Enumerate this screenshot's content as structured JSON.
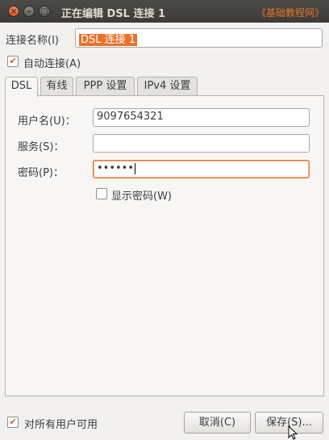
{
  "window": {
    "title": "正在编辑 DSL 连接 1",
    "watermark": "《基础教程网》",
    "close_glyph": "×",
    "min_glyph": "–",
    "max_glyph": "□"
  },
  "connection_name": {
    "label": "连接名称(I)",
    "value": "DSL 连接 1"
  },
  "auto_connect": {
    "label": "自动连接(A)",
    "checked": true,
    "check_glyph": "✔"
  },
  "tabs": [
    {
      "label": "DSL",
      "active": true
    },
    {
      "label": "有线",
      "active": false
    },
    {
      "label": "PPP 设置",
      "active": false
    },
    {
      "label": "IPv4 设置",
      "active": false
    }
  ],
  "dsl": {
    "username_label": "用户名(U)：",
    "username_value": "9097654321",
    "service_label": "服务(S)：",
    "service_value": "",
    "password_label": "密码(P)：",
    "password_value": "••••••",
    "show_password_label": "显示密码(W)"
  },
  "footer": {
    "all_users_label": "对所有用户可用",
    "cancel_label": "取消(C)",
    "save_label": "保存(S)..."
  },
  "colors": {
    "accent": "#e8732c",
    "titlebar": "#3c3b37"
  }
}
